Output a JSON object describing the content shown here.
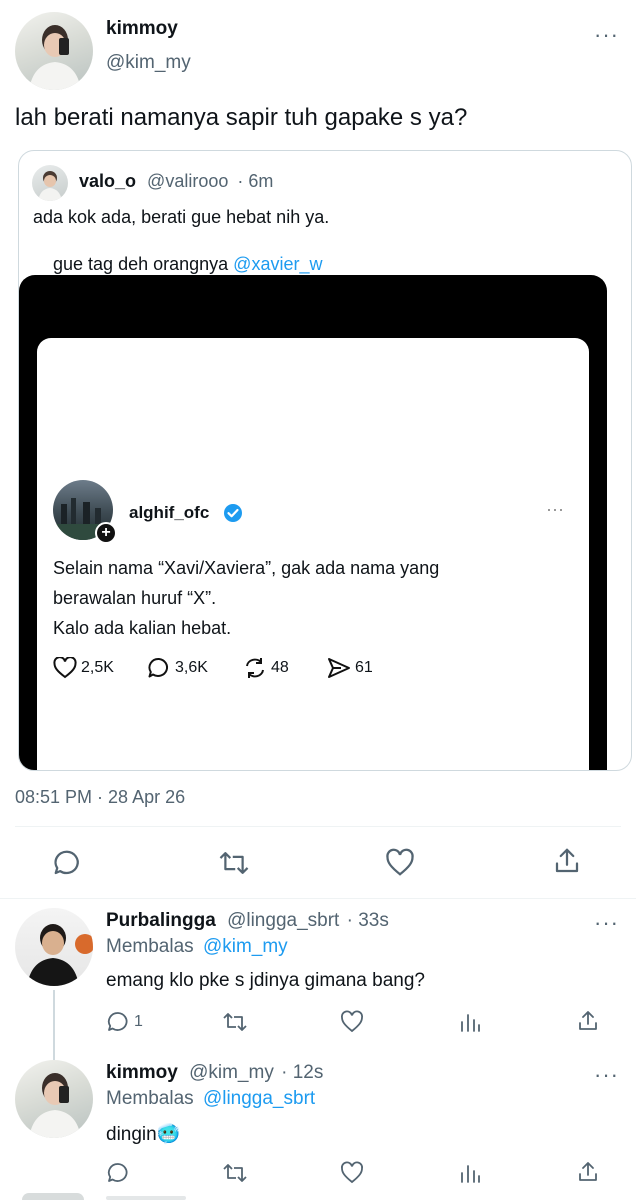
{
  "main_tweet": {
    "display_name": "kimmoy",
    "handle": "@kim_my",
    "text": "lah berati namanya sapir tuh gapake s ya?",
    "timestamp": "08:51 PM · 28 Apr 26"
  },
  "quoted_tweet": {
    "display_name": "valo_o",
    "handle": "@valirooo",
    "time": "· 6m",
    "line1": "ada kok ada, berati gue hebat nih ya.",
    "line2_prefix": "gue tag deh orangnya ",
    "line2_mention": "@xavier_w"
  },
  "embedded_post": {
    "username": "alghif_ofc",
    "line1": "Selain nama “Xavi/Xaviera”, gak ada nama yang",
    "line2": "berawalan huruf “X”.",
    "line3": "Kalo ada kalian hebat.",
    "likes": "2,5K",
    "comments": "3,6K",
    "reposts": "48",
    "shares": "61"
  },
  "replies": [
    {
      "display_name": "Purbalingga",
      "handle": "@lingga_sbrt",
      "time": "· 33s",
      "replying_label": "Membalas",
      "replying_to": "@kim_my",
      "text": "emang klo pke s jdinya gimana bang?",
      "reply_count": "1"
    },
    {
      "display_name": "kimmoy",
      "handle": "@kim_my",
      "time": "· 12s",
      "replying_label": "Membalas",
      "replying_to": "@lingga_sbrt",
      "text": "dingin",
      "emoji": "🥶"
    }
  ],
  "colors": {
    "accent": "#1d9bf0",
    "muted": "#536471",
    "border": "#eff3f4"
  }
}
